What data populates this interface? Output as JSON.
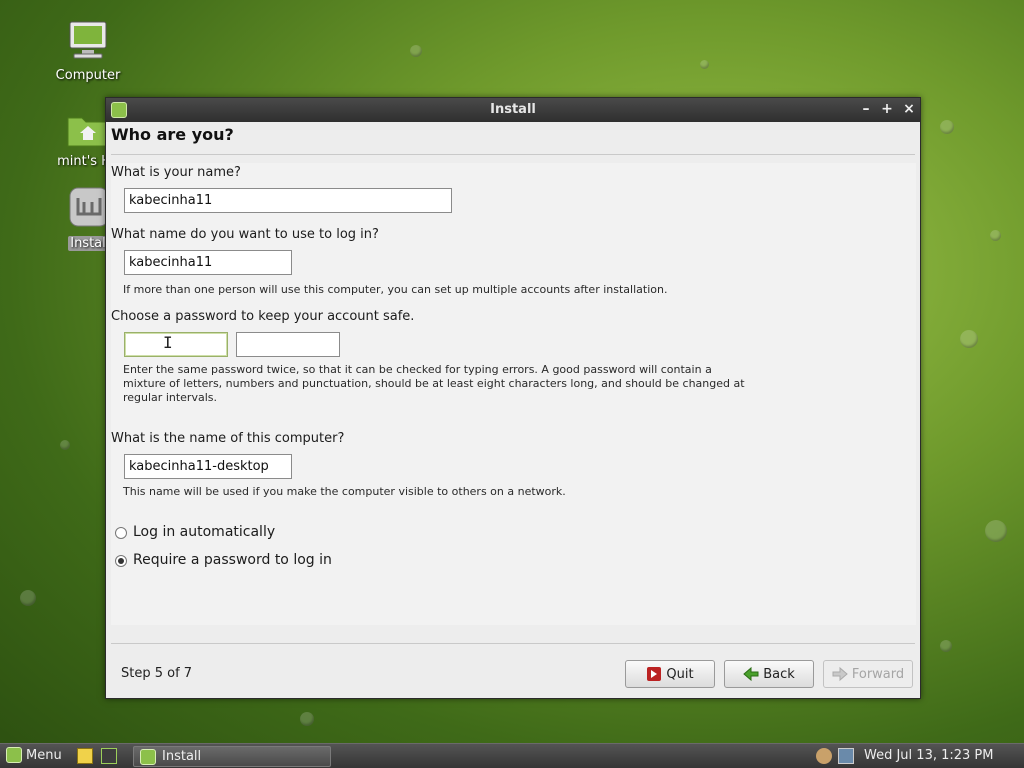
{
  "desktop": {
    "icons": [
      {
        "label": "Computer"
      },
      {
        "label": "mint's Ho"
      },
      {
        "label": "Instal"
      }
    ]
  },
  "window": {
    "title": "Install",
    "controls": {
      "minimize": "–",
      "maximize": "+",
      "close": "×"
    },
    "heading": "Who are you?",
    "name_question": "What is your name?",
    "name_value": "kabecinha11",
    "login_question": "What name do you want to use to log in?",
    "login_value": "kabecinha11",
    "login_hint": "If more than one person will use this computer, you can set up multiple accounts after installation.",
    "password_question": "Choose a password to keep your account safe.",
    "password_value": "",
    "password_confirm_value": "",
    "password_hint_1": "Enter the same password twice, so that it can be checked for typing errors. A good password will contain a",
    "password_hint_2": "mixture of letters, numbers and punctuation, should be at least eight characters long, and should be changed at",
    "password_hint_3": "regular intervals.",
    "computer_question": "What is the name of this computer?",
    "computer_value": "kabecinha11-desktop",
    "computer_hint": "This name will be used if you make the computer visible to others on a network.",
    "radio_auto": "Log in automatically",
    "radio_password": "Require a password to log in",
    "step": "Step 5 of 7",
    "quit_label": "Quit",
    "back_label": "Back",
    "forward_label": "Forward"
  },
  "taskbar": {
    "menu_label": "Menu",
    "window_label": "Install",
    "clock": "Wed Jul 13,  1:23 PM"
  },
  "colors": {
    "accent": "#8cc04a",
    "window_bg": "#ededed",
    "titlebar": "#3a3a3a"
  }
}
